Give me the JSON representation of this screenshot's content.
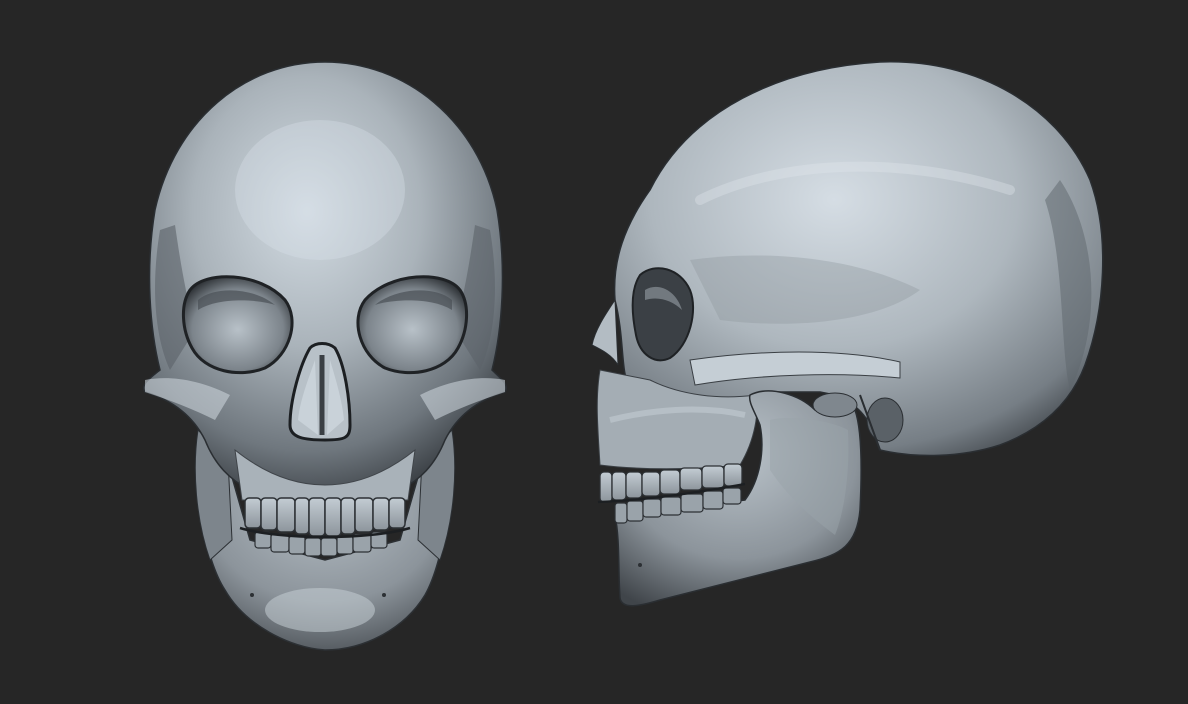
{
  "scene": {
    "background": "#262626",
    "material_base": "#9ea6ad",
    "material_highlight": "#cfd8df",
    "material_shadow": "#4a5056",
    "models": [
      {
        "name": "skull-front-view",
        "view": "front"
      },
      {
        "name": "skull-side-view",
        "view": "right profile"
      }
    ]
  }
}
